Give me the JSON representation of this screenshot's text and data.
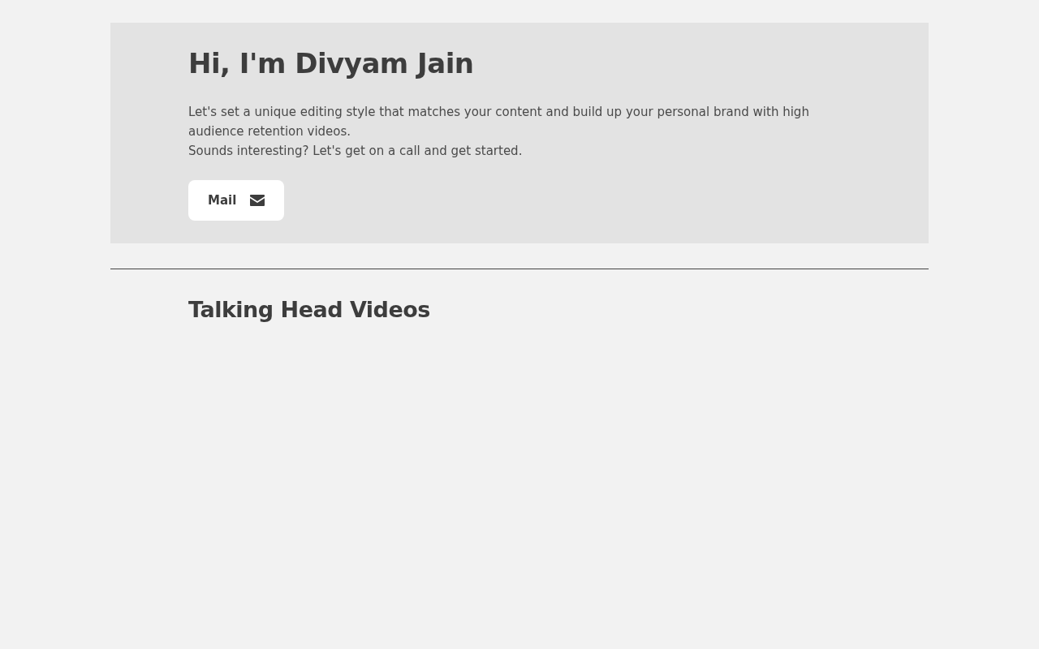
{
  "hero": {
    "title": "Hi, I'm Divyam Jain",
    "paragraphs": [
      "Let's set a unique editing style that matches your content and build up your personal brand with high audience retention videos.",
      "Sounds interesting? Let's get on a call and get started."
    ],
    "button": {
      "label": "Mail"
    }
  },
  "section": {
    "title": "Talking Head Videos"
  }
}
